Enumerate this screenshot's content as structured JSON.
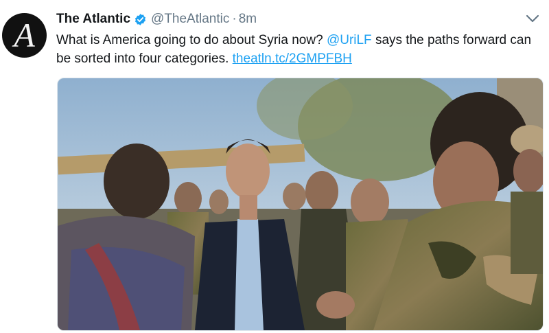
{
  "tweet": {
    "author_name": "The Atlantic",
    "handle": "@TheAtlantic",
    "separator": "·",
    "time": "8m",
    "avatar_letter": "A",
    "text_part1": "What is America going to do about Syria now? ",
    "mention": "@UriLF",
    "text_part2": " says the paths forward can be sorted into four categories. ",
    "link": "theatln.tc/2GMPFBH"
  },
  "colors": {
    "accent": "#1da1f2",
    "secondary_text": "#657786"
  },
  "icons": {
    "verified": "verified-badge-icon",
    "caret": "chevron-down-icon"
  }
}
